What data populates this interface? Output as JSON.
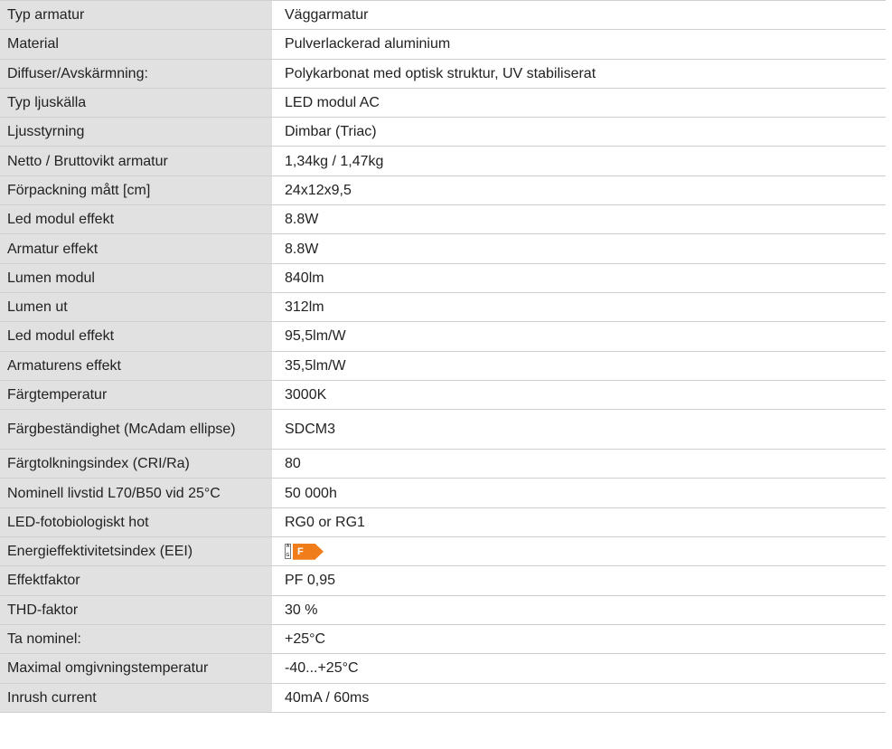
{
  "rows": [
    {
      "label": "Typ armatur",
      "value": "Väggarmatur"
    },
    {
      "label": "Material",
      "value": "Pulverlackerad aluminium"
    },
    {
      "label": "Diffuser/Avskärmning:",
      "value": "Polykarbonat med optisk struktur, UV stabiliserat"
    },
    {
      "label": "Typ ljuskälla",
      "value": "LED modul AC"
    },
    {
      "label": "Ljusstyrning",
      "value": "Dimbar (Triac)"
    },
    {
      "label": "Netto / Bruttovikt armatur",
      "value": "1,34kg / 1,47kg"
    },
    {
      "label": "Förpackning mått [cm]",
      "value": "24x12x9,5"
    },
    {
      "label": "Led modul effekt",
      "value": "8.8W"
    },
    {
      "label": "Armatur effekt",
      "value": "8.8W"
    },
    {
      "label": "Lumen modul",
      "value": "840lm"
    },
    {
      "label": "Lumen ut",
      "value": "312lm"
    },
    {
      "label": "Led modul effekt",
      "value": "95,5lm/W"
    },
    {
      "label": "Armaturens effekt",
      "value": "35,5lm/W"
    },
    {
      "label": "Färgtemperatur",
      "value": "3000K"
    },
    {
      "label": "Färgbeständighet (McAdam ellipse)",
      "value": "SDCM3"
    },
    {
      "label": "Färgtolkningsindex (CRI/Ra)",
      "value": "80"
    },
    {
      "label": "Nominell livstid L70/B50 vid 25°C",
      "value": "50 000h"
    },
    {
      "label": "LED-fotobiologiskt hot",
      "value": "RG0 or RG1"
    },
    {
      "label": "Energieffektivitetsindex (EEI)",
      "eei": {
        "class": "F",
        "scale_top": "A",
        "scale_bottom": "G",
        "color": "#f07d1a"
      }
    },
    {
      "label": "Effektfaktor",
      "value": "PF 0,95"
    },
    {
      "label": "THD-faktor",
      "value": "30 %"
    },
    {
      "label": "Ta nominel:",
      "value": "+25°C"
    },
    {
      "label": "Maximal omgivningstemperatur",
      "value": "-40...+25°C"
    },
    {
      "label": "Inrush current",
      "value": "40mA / 60ms"
    }
  ]
}
